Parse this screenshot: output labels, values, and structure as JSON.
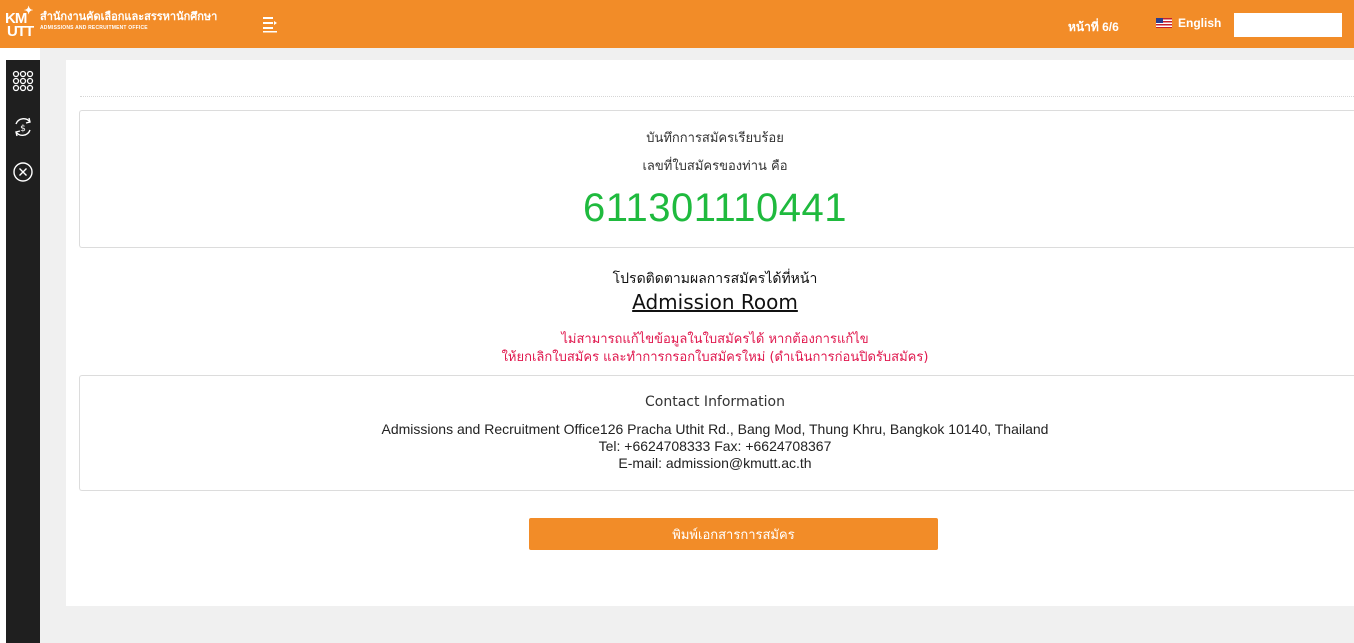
{
  "header": {
    "logo_mark_top": "KM",
    "logo_mark_bottom": "UTT",
    "logo_title_th": "สำนักงานคัดเลือกและสรรหานักศึกษา",
    "logo_title_en": "ADMISSIONS AND RECRUITMENT OFFICE",
    "page_indicator": "หน้าที่ 6/6",
    "language_label": "English",
    "search_value": "",
    "accent_color": "#f28c28"
  },
  "sidebar": {
    "items": [
      {
        "icon": "grid-icon"
      },
      {
        "icon": "currency-refresh-icon"
      },
      {
        "icon": "close-circle-icon"
      }
    ]
  },
  "result": {
    "saved_message": "บันทึกการสมัครเรียบร้อย",
    "application_number_label": "เลขที่ใบสมัครของท่าน คือ",
    "application_number": "611301110441",
    "number_color": "#1fba3e"
  },
  "follow": {
    "message": "โปรดติดตามผลการสมัครได้ที่หน้า",
    "link_label": "Admission Room",
    "warning_line_1": "ไม่สามารถแก้ไขข้อมูลในใบสมัครได้ หากต้องการแก้ไข",
    "warning_line_2": "ให้ยกเลิกใบสมัคร และทำการกรอกใบสมัครใหม่ (ดำเนินการก่อนปิดรับสมัคร)",
    "warning_color": "#e0184e"
  },
  "contact": {
    "title": "Contact Information",
    "address": "Admissions and Recruitment Office126 Pracha Uthit Rd., Bang Mod, Thung Khru, Bangkok 10140, Thailand",
    "phone": "Tel: +6624708333 Fax: +6624708367",
    "email": "E-mail: admission@kmutt.ac.th"
  },
  "actions": {
    "print_label": "พิมพ์เอกสารการสมัคร"
  }
}
